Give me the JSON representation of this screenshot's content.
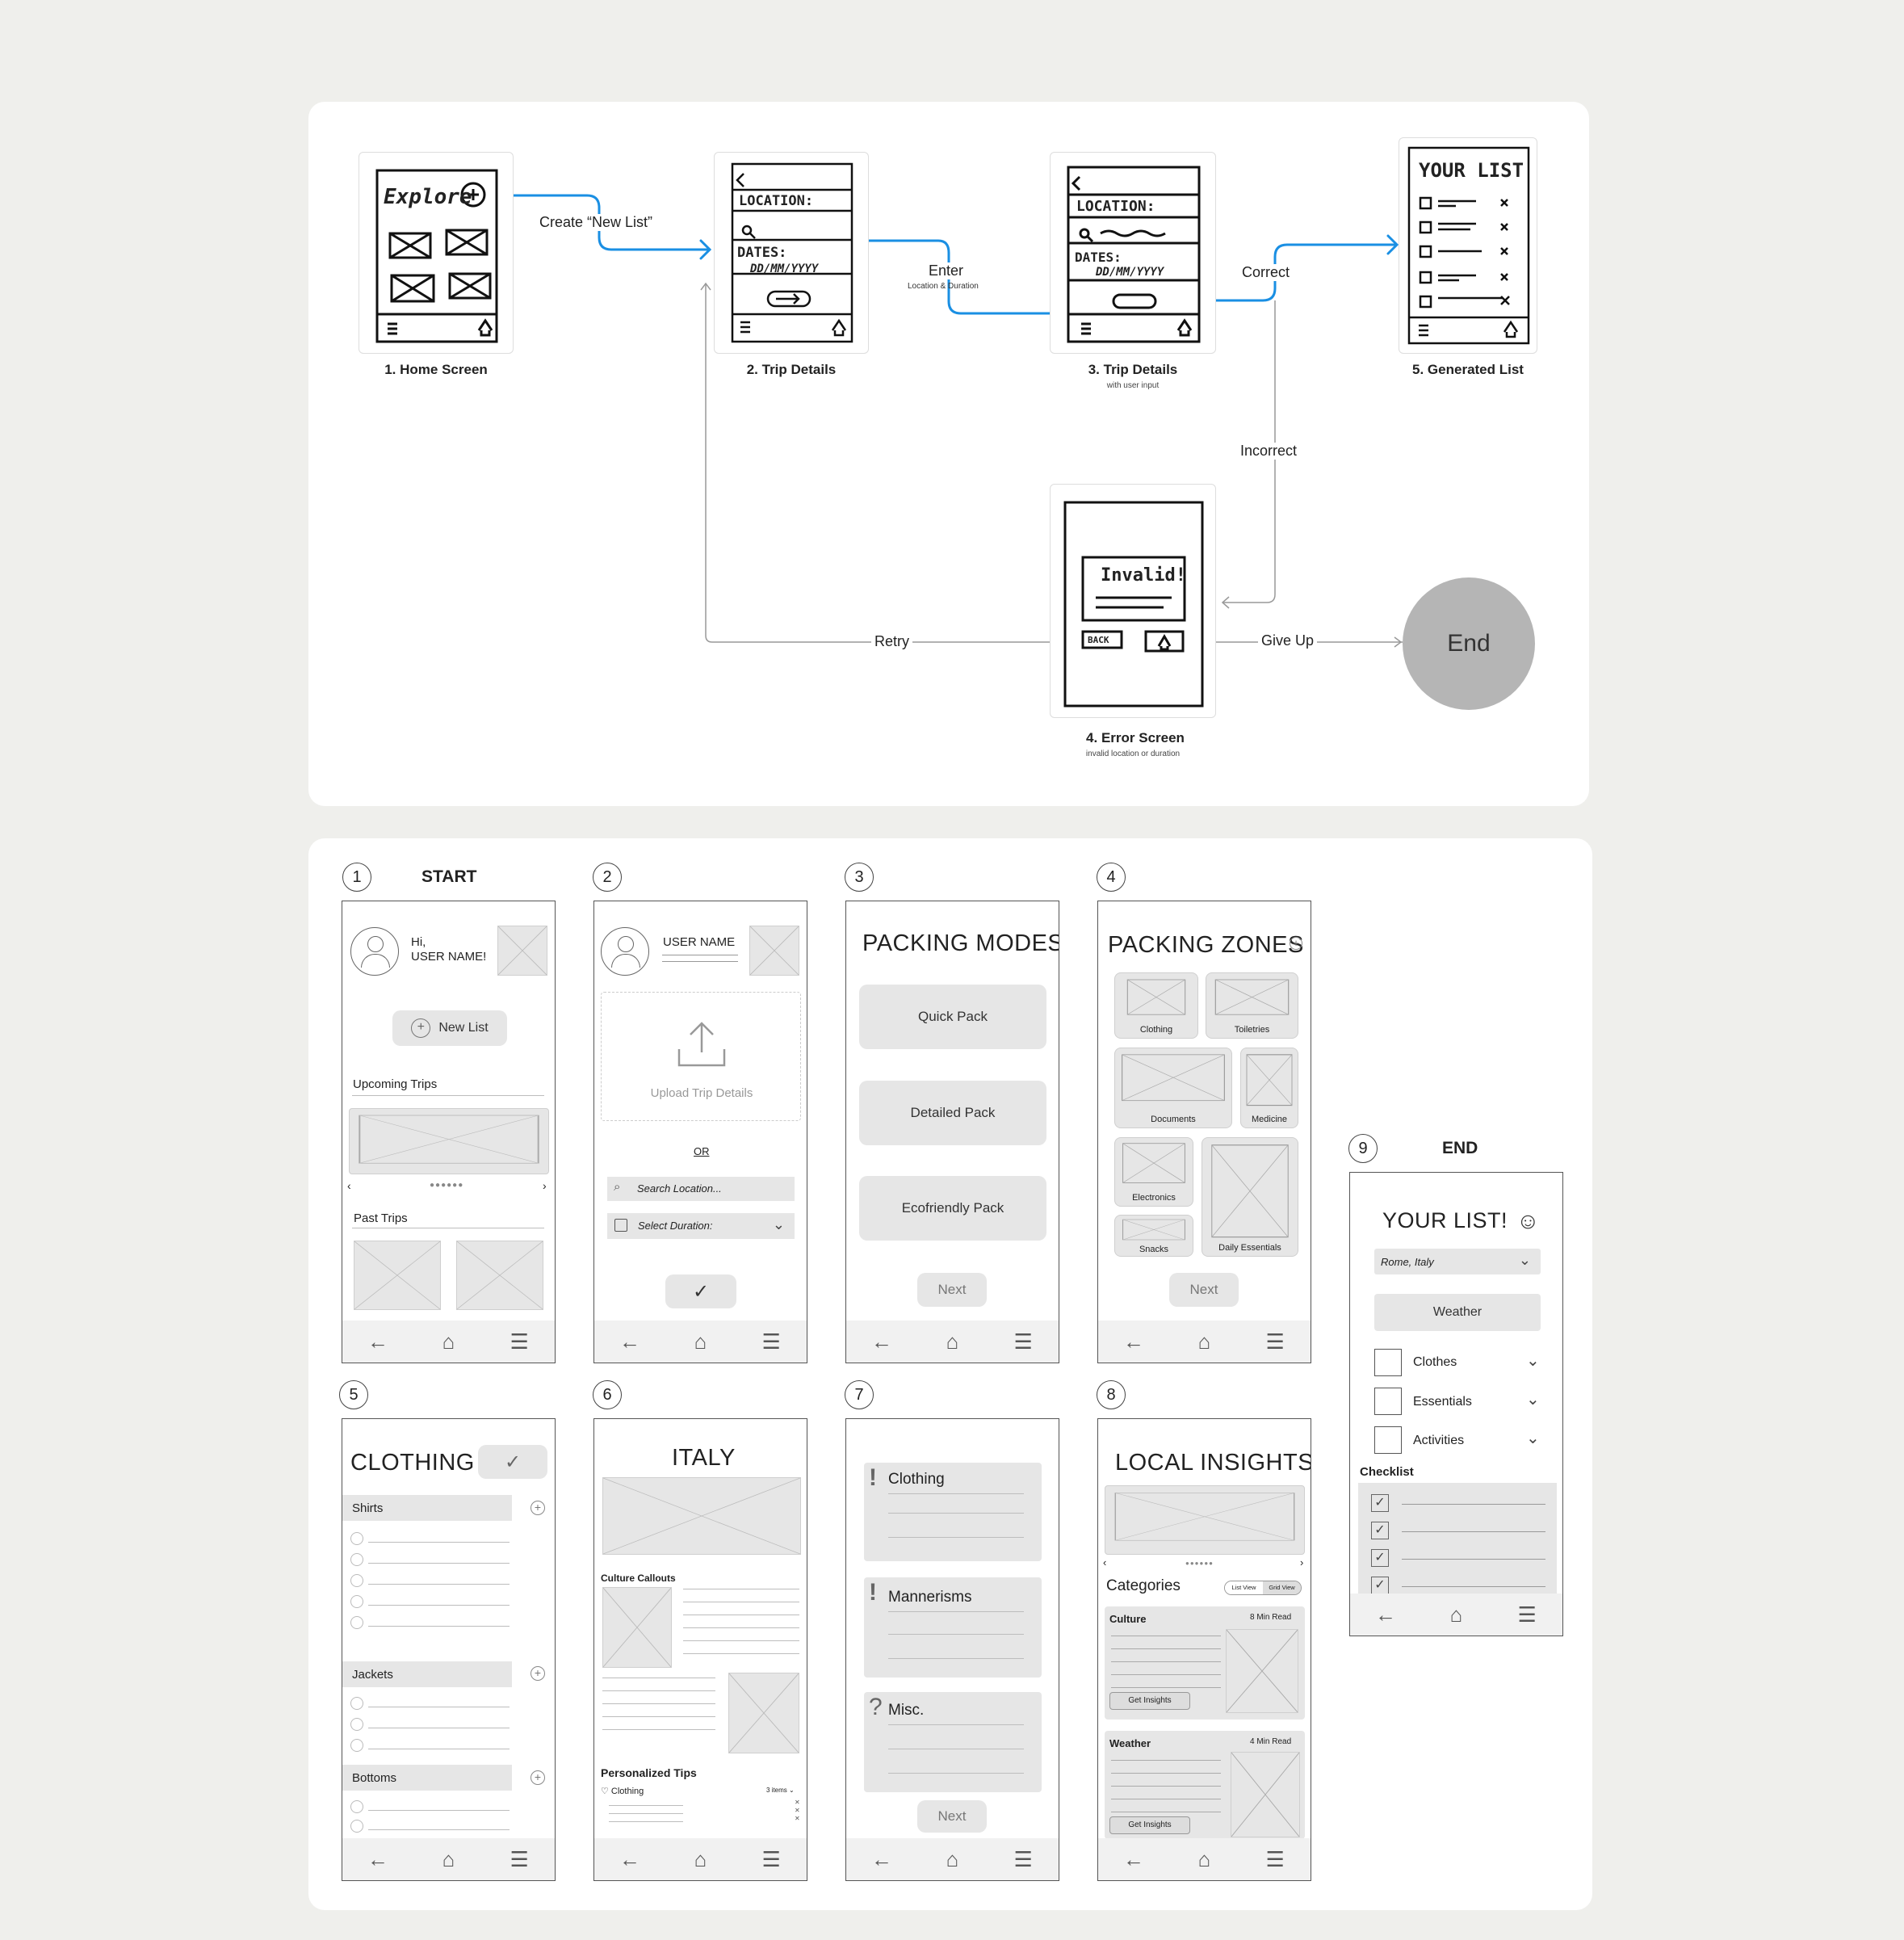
{
  "flow": {
    "edges": {
      "create": "Create “New List”",
      "enter": "Enter",
      "enter_sub": "Location & Duration",
      "correct": "Correct",
      "incorrect": "Incorrect",
      "retry": "Retry",
      "give_up": "Give Up"
    },
    "nodes": {
      "home": "1. Home Screen",
      "trip": "2. Trip Details",
      "trip_input": "3. Trip Details",
      "trip_input_sub": "with user input",
      "generated": "5. Generated List",
      "error": "4. Error Screen",
      "error_sub": "invalid location or duration",
      "end": "End"
    },
    "sketch": {
      "explore": "Explore",
      "location": "LOCATION:",
      "dates": "DATES:",
      "date_fmt": "DD/MM/YYYY",
      "your_list": "YOUR LIST",
      "invalid": "Invalid!",
      "back": "BACK"
    }
  },
  "screens": {
    "nums": [
      "1",
      "2",
      "3",
      "4",
      "5",
      "6",
      "7",
      "8",
      "9"
    ],
    "start": "START",
    "end": "END",
    "s1": {
      "greeting": "Hi,",
      "user": "USER NAME!",
      "new_list": "New List",
      "upcoming": "Upcoming Trips",
      "past": "Past Trips"
    },
    "s2": {
      "user": "USER NAME",
      "upload": "Upload Trip Details",
      "or": "OR",
      "search": "Search Location...",
      "duration": "Select Duration:"
    },
    "s3": {
      "title": "PACKING MODES",
      "modes": [
        "Quick Pack",
        "Detailed Pack",
        "Ecofriendly Pack"
      ],
      "next": "Next"
    },
    "s4": {
      "title": "PACKING ZONES",
      "zones": [
        "Clothing",
        "Toiletries",
        "Documents",
        "Medicine",
        "Electronics",
        "Snacks",
        "Daily Essentials"
      ],
      "next": "Next"
    },
    "s5": {
      "title": "CLOTHING",
      "sections": [
        "Shirts",
        "Jackets",
        "Bottoms"
      ]
    },
    "s6": {
      "title": "ITALY",
      "callouts": "Culture Callouts",
      "tips": "Personalized Tips",
      "clothing": "♡ Clothing",
      "items": "3 items ⌄"
    },
    "s7": {
      "cards": [
        "Clothing",
        "Mannerisms",
        "Misc."
      ],
      "marks": [
        "!",
        "!",
        "?"
      ],
      "next": "Next"
    },
    "s8": {
      "title": "LOCAL INSIGHTS",
      "categories": "Categories",
      "list_view": "List View",
      "grid_view": "Grid View",
      "cards": [
        {
          "name": "Culture",
          "time": "8 Min Read",
          "btn": "Get Insights"
        },
        {
          "name": "Weather",
          "time": "4 Min Read",
          "btn": "Get Insights"
        }
      ]
    },
    "s9": {
      "title": "YOUR LIST!",
      "location": "Rome, Italy",
      "weather": "Weather",
      "items": [
        "Clothes",
        "Essentials",
        "Activities"
      ],
      "checklist": "Checklist"
    }
  }
}
